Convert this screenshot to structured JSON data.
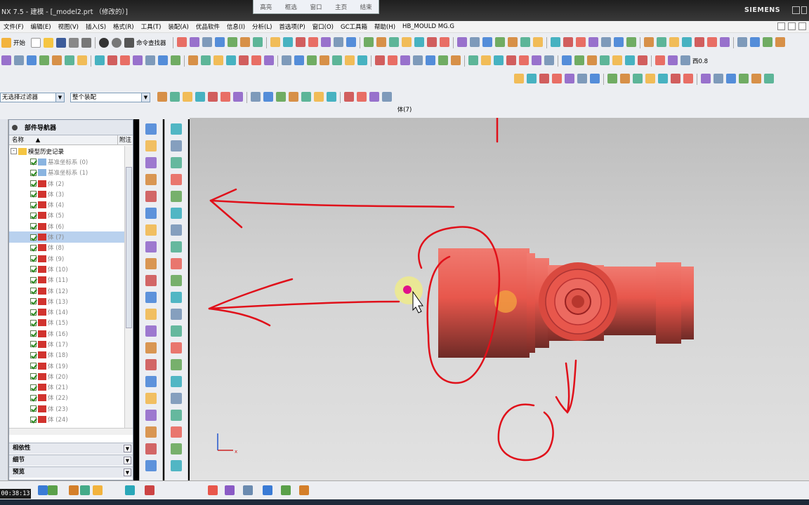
{
  "window": {
    "title": "NX 7.5 - 建模 - [_model2.prt （修改的）]",
    "brand": "SIEMENS"
  },
  "float_toolbar": [
    "高亮",
    "框选",
    "窗口",
    "主页",
    "结束"
  ],
  "menu": [
    "文件(F)",
    "编辑(E)",
    "视图(V)",
    "插入(S)",
    "格式(R)",
    "工具(T)",
    "装配(A)",
    "优品软件",
    "信息(I)",
    "分析(L)",
    "首选项(P)",
    "窗口(O)",
    "GC工具箱",
    "帮助(H)",
    "HB_MOULD MG.G"
  ],
  "toolbar": {
    "start_label": "开始",
    "command_finder": "命令查找器",
    "scale_label": "西0.8"
  },
  "filter": {
    "type_filter": "无选择过滤器",
    "scope": "整个装配"
  },
  "status_line": "体(7)",
  "navigator": {
    "title": "部件导航器",
    "col_name": "名称",
    "col_note": "附注",
    "root": "模型历史记录",
    "items": [
      {
        "label": "基准坐标系 (0)",
        "icon": "csys-icon"
      },
      {
        "label": "基准坐标系 (1)",
        "icon": "csys-icon"
      },
      {
        "label": "体 (2)",
        "icon": "body-icon"
      },
      {
        "label": "体 (3)",
        "icon": "body-icon"
      },
      {
        "label": "体 (4)",
        "icon": "body-icon"
      },
      {
        "label": "体 (5)",
        "icon": "body-icon"
      },
      {
        "label": "体 (6)",
        "icon": "body-icon"
      },
      {
        "label": "体 (7)",
        "icon": "body-icon",
        "selected": true
      },
      {
        "label": "体 (8)",
        "icon": "body-icon"
      },
      {
        "label": "体 (9)",
        "icon": "body-icon"
      },
      {
        "label": "体 (10)",
        "icon": "body-icon"
      },
      {
        "label": "体 (11)",
        "icon": "body-icon"
      },
      {
        "label": "体 (12)",
        "icon": "body-icon"
      },
      {
        "label": "体 (13)",
        "icon": "body-icon"
      },
      {
        "label": "体 (14)",
        "icon": "body-icon"
      },
      {
        "label": "体 (15)",
        "icon": "body-icon"
      },
      {
        "label": "体 (16)",
        "icon": "body-icon"
      },
      {
        "label": "体 (17)",
        "icon": "body-icon"
      },
      {
        "label": "体 (18)",
        "icon": "body-icon"
      },
      {
        "label": "体 (19)",
        "icon": "body-icon"
      },
      {
        "label": "体 (20)",
        "icon": "body-icon"
      },
      {
        "label": "体 (21)",
        "icon": "body-icon"
      },
      {
        "label": "体 (22)",
        "icon": "body-icon"
      },
      {
        "label": "体 (23)",
        "icon": "body-icon"
      },
      {
        "label": "体 (24)",
        "icon": "body-icon"
      }
    ],
    "sections": [
      "相依性",
      "细节",
      "预览"
    ]
  },
  "timer": "00:38:13",
  "colors": {
    "part": "#e8574c",
    "annotation": "#e0101a",
    "highlight": "#b9d1ee"
  }
}
